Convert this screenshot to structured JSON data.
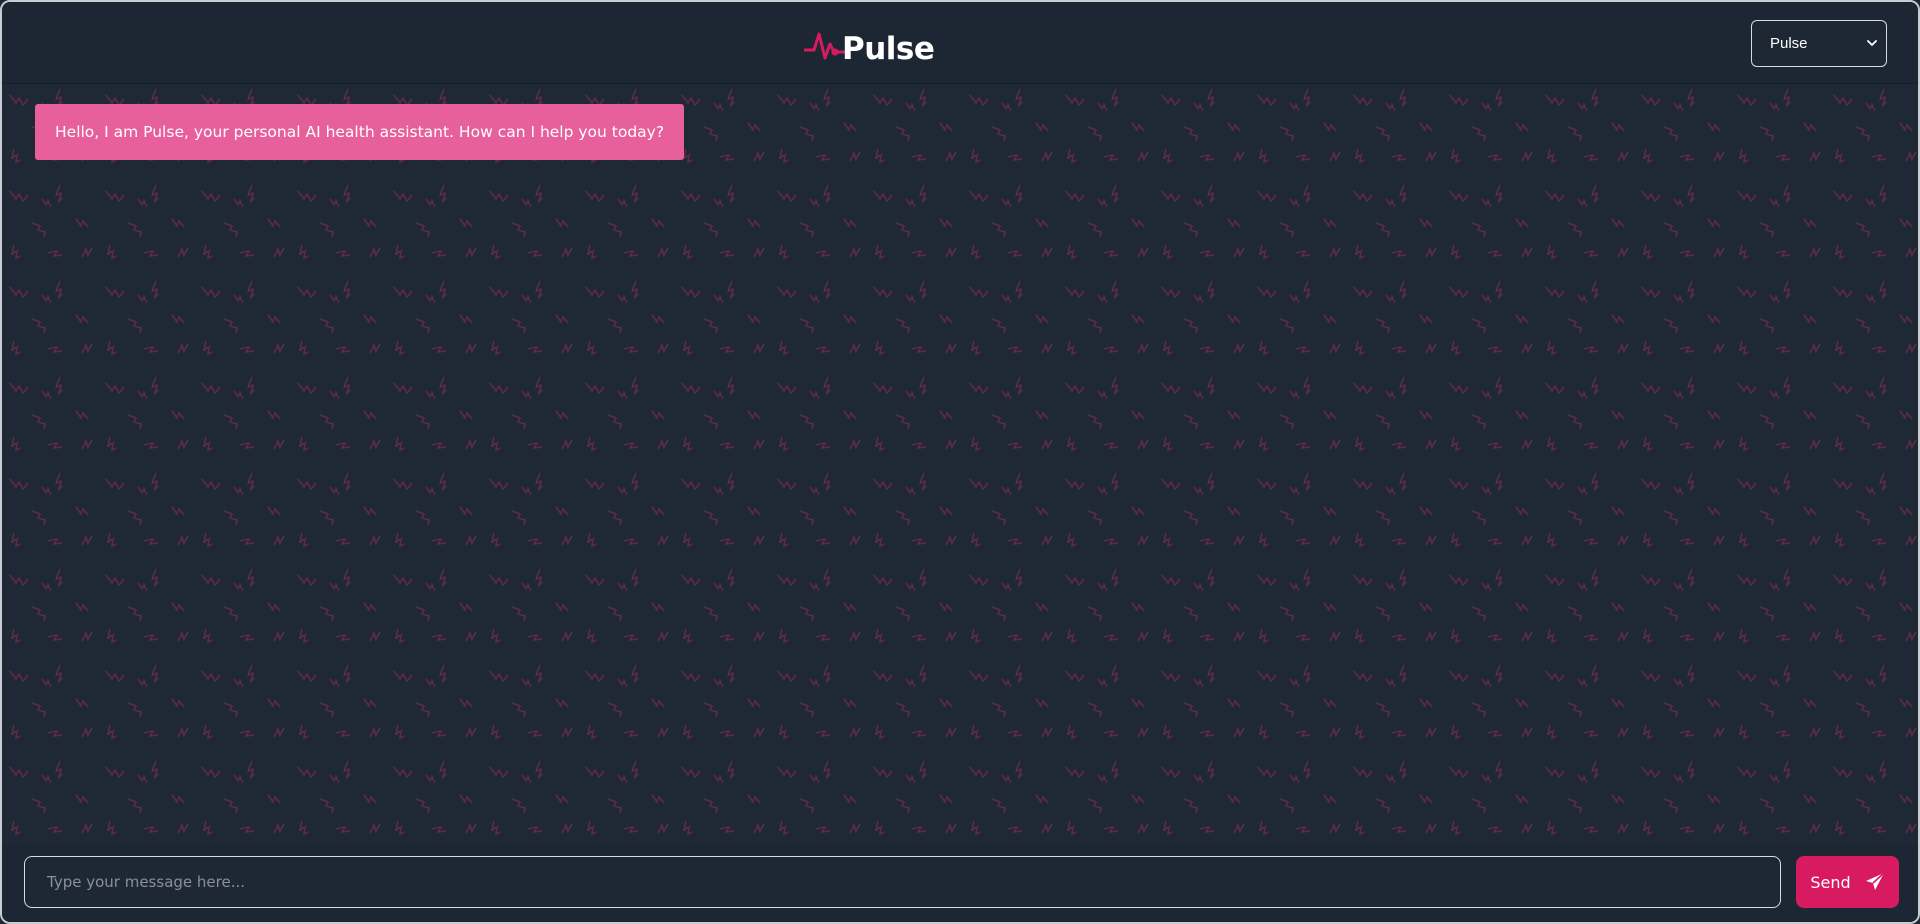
{
  "header": {
    "logo_text": "Pulse",
    "model_select": {
      "selected": "Pulse",
      "options": [
        "Pulse"
      ]
    }
  },
  "chat": {
    "messages": [
      {
        "sender": "bot",
        "text": "Hello, I am Pulse, your personal AI health assistant. How can I help you today?"
      }
    ]
  },
  "composer": {
    "placeholder": "Type your message here...",
    "value": "",
    "send_label": "Send"
  },
  "colors": {
    "accent": "#d81b60",
    "bubble": "#e7609b",
    "background": "#1e2834"
  },
  "icons": {
    "logo": "heartbeat-icon",
    "send": "paper-plane-icon",
    "select": "chevron-down-icon"
  }
}
